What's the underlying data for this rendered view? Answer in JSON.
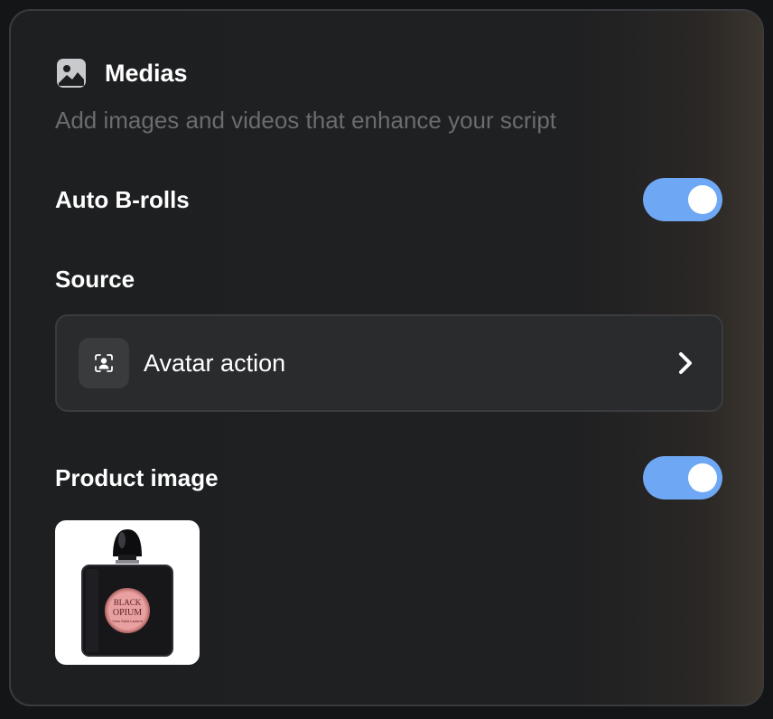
{
  "panel": {
    "title": "Medias",
    "title_icon": "image-icon",
    "subtitle": "Add images and videos that enhance your script"
  },
  "auto_brolls": {
    "label": "Auto B-rolls",
    "enabled": true
  },
  "source": {
    "label": "Source",
    "selected": "Avatar action",
    "icon": "avatar-icon"
  },
  "product_image": {
    "label": "Product image",
    "enabled": true,
    "thumbnail_icon": "perfume-bottle-image",
    "bottle_text_line1": "BLACK",
    "bottle_text_line2": "OPIUM",
    "bottle_text_line3": "Yves Saint Laurent"
  },
  "colors": {
    "toggle_on": "#6ea8f5",
    "panel_bg": "#1e1f21",
    "muted_text": "#6b6c70"
  }
}
